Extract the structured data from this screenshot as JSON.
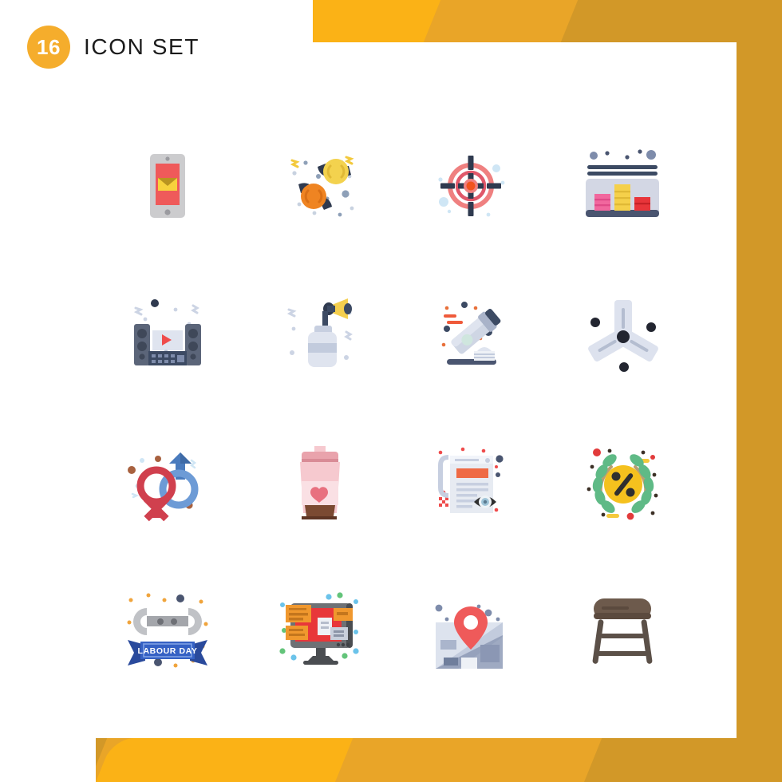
{
  "header": {
    "count": "16",
    "title": "ICON SET"
  },
  "theme": {
    "brand_yellow_light": "#fbb216",
    "brand_yellow_mid": "#e9a528",
    "brand_yellow_dark": "#d29828",
    "badge_yellow": "#f5ad2c",
    "title_color": "#1b1b1b",
    "card_background": "#ffffff",
    "page_background": "#ffffff"
  },
  "grid": {
    "columns": 4,
    "rows": 4,
    "total": 16
  },
  "icons": [
    {
      "position": 1,
      "row": 1,
      "col": 1,
      "name": "mobile-email-icon",
      "label": "Mobile Email"
    },
    {
      "position": 2,
      "row": 1,
      "col": 2,
      "name": "candy-icon",
      "label": "Candy"
    },
    {
      "position": 3,
      "row": 1,
      "col": 3,
      "name": "target-icon",
      "label": "Target"
    },
    {
      "position": 4,
      "row": 1,
      "col": 4,
      "name": "dashboard-chart-icon",
      "label": "Dashboard Chart"
    },
    {
      "position": 5,
      "row": 2,
      "col": 1,
      "name": "home-theater-icon",
      "label": "Home Theater"
    },
    {
      "position": 6,
      "row": 2,
      "col": 2,
      "name": "gas-torch-icon",
      "label": "Gas Torch"
    },
    {
      "position": 7,
      "row": 2,
      "col": 3,
      "name": "toothpaste-icon",
      "label": "Toothpaste"
    },
    {
      "position": 8,
      "row": 2,
      "col": 4,
      "name": "y-connector-icon",
      "label": "Y Connector"
    },
    {
      "position": 9,
      "row": 3,
      "col": 1,
      "name": "gender-symbols-icon",
      "label": "Gender Symbols"
    },
    {
      "position": 10,
      "row": 3,
      "col": 2,
      "name": "coffee-cup-heart-icon",
      "label": "Coffee Cup Heart"
    },
    {
      "position": 11,
      "row": 3,
      "col": 3,
      "name": "news-view-icon",
      "label": "News View"
    },
    {
      "position": 12,
      "row": 3,
      "col": 4,
      "name": "discount-wreath-icon",
      "label": "Discount Wreath"
    },
    {
      "position": 13,
      "row": 4,
      "col": 1,
      "name": "labour-day-wrench-icon",
      "label": "Labour Day Wrench"
    },
    {
      "position": 14,
      "row": 4,
      "col": 2,
      "name": "monitor-notes-icon",
      "label": "Monitor Notes"
    },
    {
      "position": 15,
      "row": 4,
      "col": 3,
      "name": "map-location-icon",
      "label": "Map Location"
    },
    {
      "position": 16,
      "row": 4,
      "col": 4,
      "name": "stool-icon",
      "label": "Stool"
    }
  ],
  "icon_text": {
    "labour_day_banner": "LABOUR DAY"
  }
}
